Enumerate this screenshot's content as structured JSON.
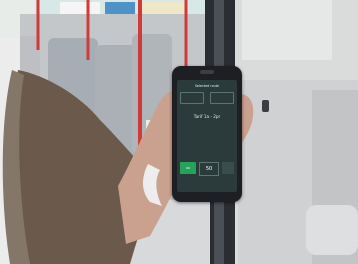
{
  "device": {
    "status_left": "",
    "status_right": "",
    "screen_title": "Selected route",
    "box_left": "",
    "box_right": "",
    "mid_text": "Tarif 1a - 2pr",
    "mid_sub": "",
    "ok_label": "OK",
    "value": "50",
    "mini": "",
    "footer": ""
  }
}
